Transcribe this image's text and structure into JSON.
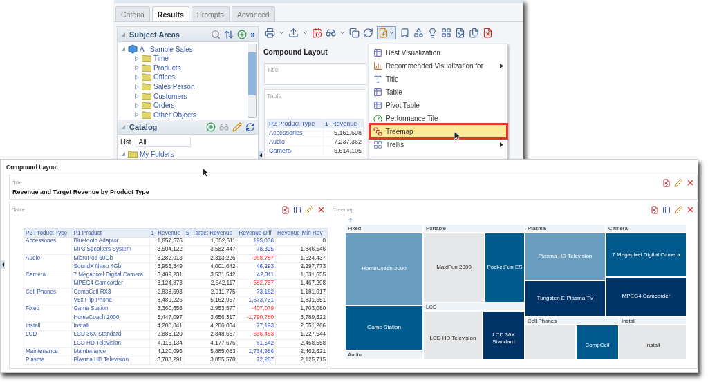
{
  "back_window": {
    "tabs": [
      {
        "label": "Criteria",
        "selected": false
      },
      {
        "label": "Results",
        "selected": true
      },
      {
        "label": "Prompts",
        "selected": false
      },
      {
        "label": "Advanced",
        "selected": false
      }
    ],
    "subject_areas": {
      "title": "Subject Areas",
      "more": "»",
      "tree": [
        {
          "label": "A - Sample Sales",
          "expanded": true,
          "children": [
            {
              "label": "Time",
              "expanded": false
            },
            {
              "label": "Products",
              "expanded": false
            },
            {
              "label": "Offices",
              "expanded": false
            },
            {
              "label": "Sales Person",
              "expanded": false
            },
            {
              "label": "Customers",
              "expanded": false
            },
            {
              "label": "Orders",
              "expanded": false
            },
            {
              "label": "Other Objects",
              "expanded": false
            }
          ]
        }
      ]
    },
    "catalog": {
      "title": "Catalog",
      "list_label": "List",
      "list_value": "All",
      "folders": [
        {
          "label": "My Folders",
          "expanded": true
        }
      ]
    },
    "layout_title": "Compound Layout",
    "title_view": {
      "label": "Title"
    },
    "table_view": {
      "label": "Table",
      "columns": [
        "P2 Product Type",
        "1- Revenue"
      ],
      "rows": [
        [
          "Accessories",
          "5,161,698"
        ],
        [
          "Audio",
          "7,237,362"
        ],
        [
          "Camera",
          "6,614,105"
        ]
      ]
    },
    "new_view_menu": [
      {
        "label": "Best Visualization",
        "submenu": false,
        "selected": false
      },
      {
        "label": "Recommended Visualization for",
        "submenu": true,
        "selected": false
      },
      {
        "label": "Title",
        "submenu": false,
        "selected": false
      },
      {
        "label": "Table",
        "submenu": false,
        "selected": false
      },
      {
        "label": "Pivot Table",
        "submenu": false,
        "selected": false
      },
      {
        "label": "Performance Tile",
        "submenu": false,
        "selected": false
      },
      {
        "label": "Treemap",
        "submenu": false,
        "selected": true
      },
      {
        "label": "Trellis",
        "submenu": true,
        "selected": false
      }
    ]
  },
  "front_window": {
    "title": "Compound Layout",
    "title_view": {
      "label": "Title",
      "heading": "Revenue and Target Revenue by Product Type"
    },
    "table_view": {
      "label": "Table",
      "columns": [
        "P2 Product Type",
        "P1 Product",
        "1- Revenue",
        "5- Target Revenue",
        "Revenue Diff",
        "Revenue-Min Rev"
      ],
      "groups": [
        {
          "type": "Accessories",
          "rows": [
            {
              "product": "Bluetooth Adaptor",
              "revenue": "1,657,576",
              "target": "1,852,611",
              "diff": "195,036",
              "negative": false,
              "min_rev": "0"
            },
            {
              "product": "MP3 Speakers System",
              "revenue": "3,504,122",
              "target": "3,582,447",
              "diff": "78,325",
              "negative": false,
              "min_rev": "1,846,546"
            }
          ]
        },
        {
          "type": "Audio",
          "rows": [
            {
              "product": "MicroPod 60Gb",
              "revenue": "3,282,013",
              "target": "2,313,226",
              "diff": "-968,787",
              "negative": true,
              "min_rev": "1,624,437"
            },
            {
              "product": "SoundX Nano 4Gb",
              "revenue": "3,955,349",
              "target": "4,001,642",
              "diff": "46,293",
              "negative": false,
              "min_rev": "2,297,773"
            }
          ]
        },
        {
          "type": "Camera",
          "rows": [
            {
              "product": "7 Megapixel Digital Camera",
              "revenue": "3,489,231",
              "target": "3,531,542",
              "diff": "42,311",
              "negative": false,
              "min_rev": "1,831,655"
            },
            {
              "product": "MPEG4 Camcorder",
              "revenue": "3,124,873",
              "target": "2,542,117",
              "diff": "-582,757",
              "negative": true,
              "min_rev": "1,467,298"
            }
          ]
        },
        {
          "type": "Cell Phones",
          "rows": [
            {
              "product": "CompCell RX3",
              "revenue": "2,838,593",
              "target": "2,911,775",
              "diff": "73,182",
              "negative": false,
              "min_rev": "1,181,017"
            },
            {
              "product": "V5x Flip Phone",
              "revenue": "3,489,226",
              "target": "5,162,957",
              "diff": "1,673,731",
              "negative": false,
              "min_rev": "1,831,651"
            }
          ]
        },
        {
          "type": "Fixed",
          "rows": [
            {
              "product": "Game Station",
              "revenue": "3,360,656",
              "target": "2,953,577",
              "diff": "-407,079",
              "negative": true,
              "min_rev": "1,703,080"
            },
            {
              "product": "HomeCoach 2000",
              "revenue": "5,447,097",
              "target": "3,656,317",
              "diff": "-1,790,780",
              "negative": true,
              "min_rev": "3,789,522"
            }
          ]
        },
        {
          "type": "Install",
          "rows": [
            {
              "product": "Install",
              "revenue": "4,208,841",
              "target": "4,286,034",
              "diff": "77,193",
              "negative": false,
              "min_rev": "2,551,266"
            }
          ]
        },
        {
          "type": "LCD",
          "rows": [
            {
              "product": "LCD 36X Standard",
              "revenue": "2,885,120",
              "target": "2,348,667",
              "diff": "-536,453",
              "negative": true,
              "min_rev": "1,227,544"
            },
            {
              "product": "LCD HD Television",
              "revenue": "4,116,134",
              "target": "4,177,676",
              "diff": "61,542",
              "negative": false,
              "min_rev": "2,458,558"
            }
          ]
        },
        {
          "type": "Maintenance",
          "rows": [
            {
              "product": "Maintenance",
              "revenue": "4,120,096",
              "target": "5,885,083",
              "diff": "1,764,986",
              "negative": false,
              "min_rev": "2,462,521"
            }
          ]
        },
        {
          "type": "Plasma",
          "rows": [
            {
              "product": "Plasma HD Television",
              "revenue": "3,783,291",
              "target": "3,855,578",
              "diff": "72,287",
              "negative": false,
              "min_rev": "2,125,715"
            }
          ]
        }
      ]
    },
    "treemap_view": {
      "label": "Treemap",
      "groups": [
        {
          "label": "Fixed",
          "tiles": [
            {
              "label": "HomeCoach 2000",
              "color": "#6a9ec0"
            },
            {
              "label": "Game Station",
              "color": "#005a8e"
            }
          ]
        },
        {
          "label": "Audio"
        },
        {
          "label": "Portable",
          "tiles": [
            {
              "label": "MaxiFun 2000",
              "color": "#e6e7e9"
            },
            {
              "label": "PocketFun ES",
              "color": "#005a8e"
            }
          ]
        },
        {
          "label": "LCD",
          "tiles": [
            {
              "label": "LCD HD Television",
              "color": "#e6e7e9"
            },
            {
              "label": "LCD 36X Standard",
              "color": "#003366"
            }
          ]
        },
        {
          "label": "Plasma",
          "tiles": [
            {
              "label": "Plasma HD Television",
              "color": "#6a9ec0"
            },
            {
              "label": "Tungsten E Plasma TV",
              "color": "#003366"
            }
          ]
        },
        {
          "label": "Camera",
          "tiles": [
            {
              "label": "7 Megapixel Digital Camera",
              "color": "#005a8e"
            },
            {
              "label": "MPEG4 Camcorder",
              "color": "#003366"
            }
          ]
        },
        {
          "label": "Cell Phones",
          "tiles": [
            {
              "color": "#e6e7e9"
            },
            {
              "label": "CompCell",
              "color": "#005a8e"
            }
          ]
        },
        {
          "label": "Install",
          "tiles": [
            {
              "label": "Install",
              "color": "#e6e7e9"
            }
          ]
        }
      ]
    }
  }
}
